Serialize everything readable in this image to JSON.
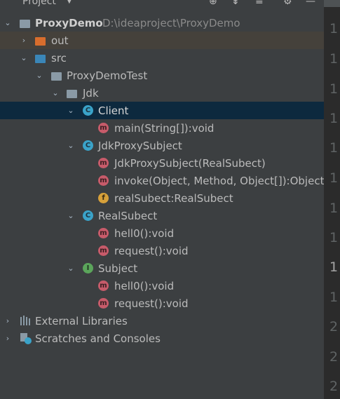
{
  "panel": {
    "title": "Project",
    "dropdown_glyph": "▼"
  },
  "toolbar_icons": [
    "globe-icon",
    "collapse-all-icon",
    "expand-icon",
    "gear-icon",
    "minimize-icon"
  ],
  "colors": {
    "background": "#3c3f41",
    "selection": "#0d293e",
    "class_icon": "#3aa3c9",
    "interface_icon": "#5ba55b",
    "method_icon": "#c75b6a",
    "field_icon": "#d7a13a",
    "excluded_folder": "#d86d2d",
    "source_folder": "#3a86b8"
  },
  "tree": {
    "project_name": "ProxyDemo",
    "project_path": "D:\\ideaproject\\ProxyDemo",
    "out_label": "out",
    "src_label": "src",
    "package_label": "ProxyDemoTest",
    "subpackage_label": "Jdk",
    "client_label": "Client",
    "client_main": "main(String[]):void",
    "jdkproxy_label": "JdkProxySubject",
    "jdkproxy_ctor": "JdkProxySubject(RealSubect)",
    "jdkproxy_invoke": "invoke(Object, Method, Object[]):Object",
    "jdkproxy_field": "realSubect:RealSubect",
    "realsubect_label": "RealSubect",
    "realsubect_hell0": "hell0():void",
    "realsubect_request": "request():void",
    "subject_label": "Subject",
    "subject_hell0": "hell0():void",
    "subject_request": "request():void",
    "external_libraries": "External Libraries",
    "scratches": "Scratches and Consoles"
  },
  "gutter": {
    "line_numbers": [
      "1",
      "1",
      "1",
      "1",
      "1",
      "1",
      "1",
      "1",
      "1",
      "1",
      "2",
      "2",
      "2"
    ],
    "current_line_index": 7
  }
}
